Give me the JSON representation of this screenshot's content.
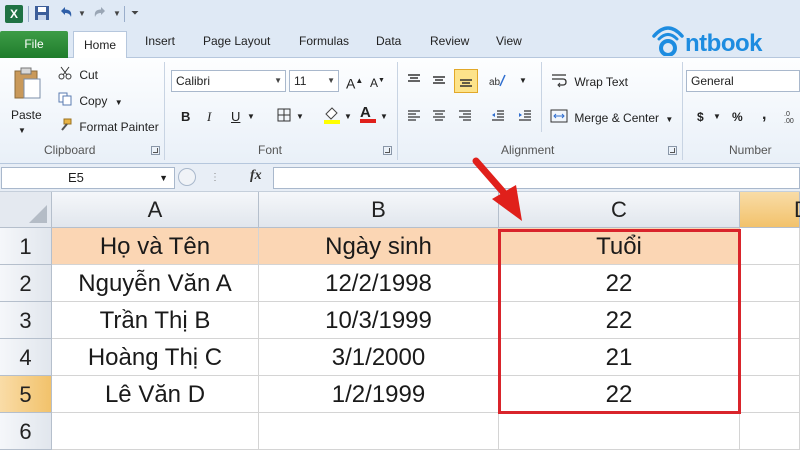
{
  "qat": {
    "undo_icon": "undo-icon",
    "redo_icon": "redo-icon",
    "save_icon": "save-icon"
  },
  "tabs": {
    "file": "File",
    "home": "Home",
    "insert": "Insert",
    "page_layout": "Page Layout",
    "formulas": "Formulas",
    "data": "Data",
    "review": "Review",
    "view": "View"
  },
  "logo": {
    "text": "ntbook",
    "color": "#1d8ce0"
  },
  "ribbon": {
    "clipboard": {
      "paste": "Paste",
      "cut": "Cut",
      "copy": "Copy",
      "format_painter": "Format Painter",
      "label": "Clipboard"
    },
    "font": {
      "name": "Calibri",
      "size": "11",
      "bold": "B",
      "italic": "I",
      "underline": "U",
      "label": "Font"
    },
    "alignment": {
      "wrap_text": "Wrap Text",
      "merge_center": "Merge & Center",
      "label": "Alignment"
    },
    "number": {
      "format": "General",
      "currency": "$",
      "percent": "%",
      "comma": ",",
      "label": "Number"
    }
  },
  "formula_bar": {
    "name_box": "E5",
    "fx": "fx",
    "content": ""
  },
  "sheet": {
    "columns": [
      "A",
      "B",
      "C",
      "D"
    ],
    "rows": [
      "1",
      "2",
      "3",
      "4",
      "5",
      "6"
    ],
    "headers": [
      "Họ và Tên",
      "Ngày sinh",
      "Tuổi"
    ],
    "data": [
      [
        "Nguyễn Văn A",
        "12/2/1998",
        "22"
      ],
      [
        "Trần Thị B",
        "10/3/1999",
        "22"
      ],
      [
        "Hoàng Thị C",
        "3/1/2000",
        "21"
      ],
      [
        "Lê Văn D",
        "1/2/1999",
        "22"
      ]
    ],
    "header_fill": "#fbd6b4",
    "highlight_color": "#d9242b",
    "active_cell": "E5"
  }
}
